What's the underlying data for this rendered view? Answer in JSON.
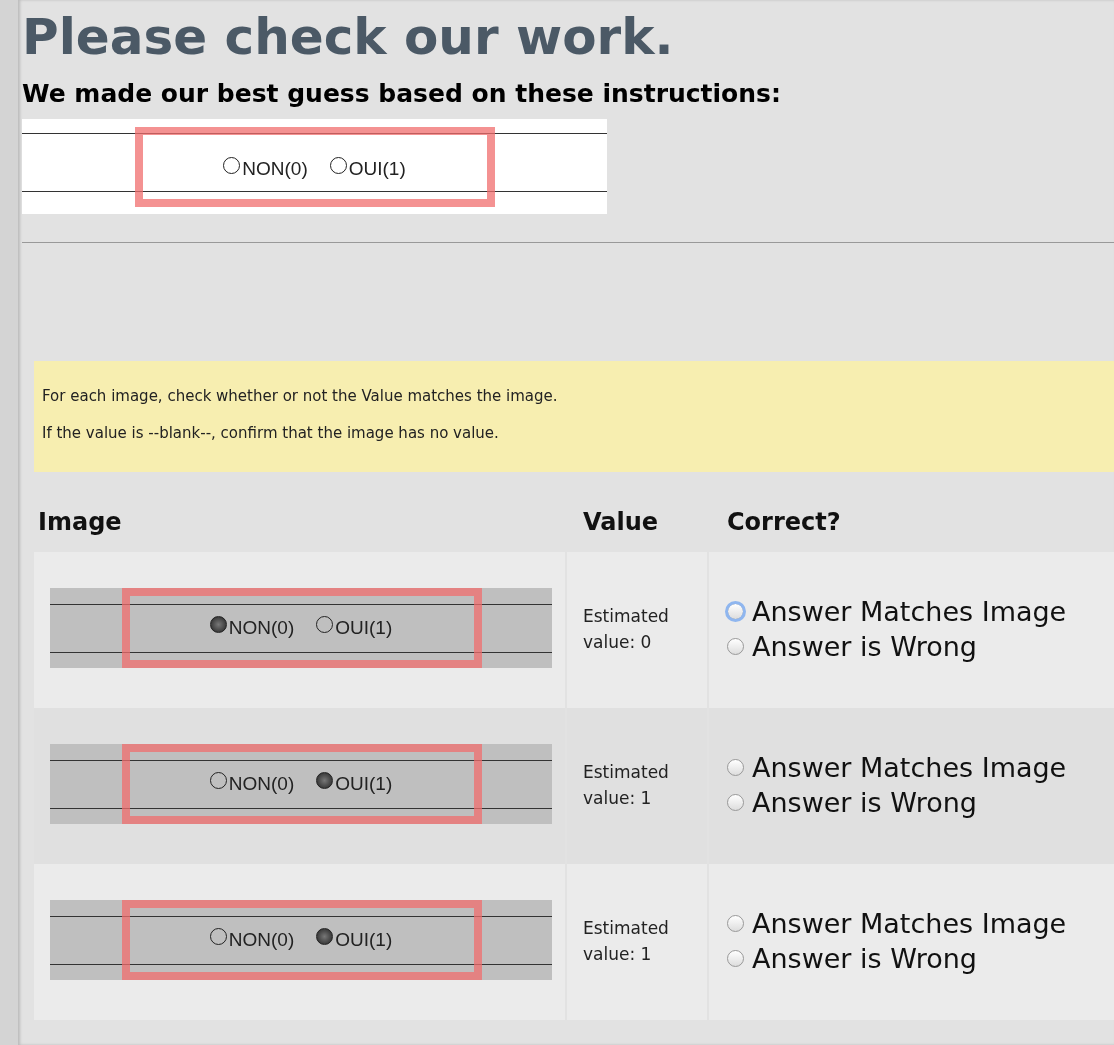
{
  "title": "Please check our work.",
  "subtitle": "We made our best guess based on these instructions:",
  "instruction_snippet": {
    "kind": "clean",
    "options": [
      {
        "label": "NON(0)",
        "filled": false
      },
      {
        "label": "OUI(1)",
        "filled": false
      }
    ]
  },
  "instructions": [
    "For each image, check whether or not the Value matches the image.",
    "If the value is --blank--, confirm that the image has no value."
  ],
  "table": {
    "columns": [
      "Image",
      "Value",
      "Correct?"
    ],
    "rows": [
      {
        "snippet": {
          "kind": "scanned",
          "options": [
            {
              "label": "NON(0)",
              "filled": true
            },
            {
              "label": "OUI(1)",
              "filled": false
            }
          ]
        },
        "value": "Estimated value: 0",
        "answers": [
          {
            "label": "Answer Matches Image",
            "selected": false,
            "focused": true
          },
          {
            "label": "Answer is Wrong",
            "selected": false,
            "focused": false
          }
        ]
      },
      {
        "snippet": {
          "kind": "scanned",
          "options": [
            {
              "label": "NON(0)",
              "filled": false
            },
            {
              "label": "OUI(1)",
              "filled": true
            }
          ]
        },
        "value": "Estimated value: 1",
        "answers": [
          {
            "label": "Answer Matches Image",
            "selected": false,
            "focused": false
          },
          {
            "label": "Answer is Wrong",
            "selected": false,
            "focused": false
          }
        ]
      },
      {
        "snippet": {
          "kind": "scanned",
          "options": [
            {
              "label": "NON(0)",
              "filled": false
            },
            {
              "label": "OUI(1)",
              "filled": true
            }
          ]
        },
        "value": "Estimated value: 1",
        "answers": [
          {
            "label": "Answer Matches Image",
            "selected": false,
            "focused": false
          },
          {
            "label": "Answer is Wrong",
            "selected": false,
            "focused": false
          }
        ]
      }
    ]
  }
}
